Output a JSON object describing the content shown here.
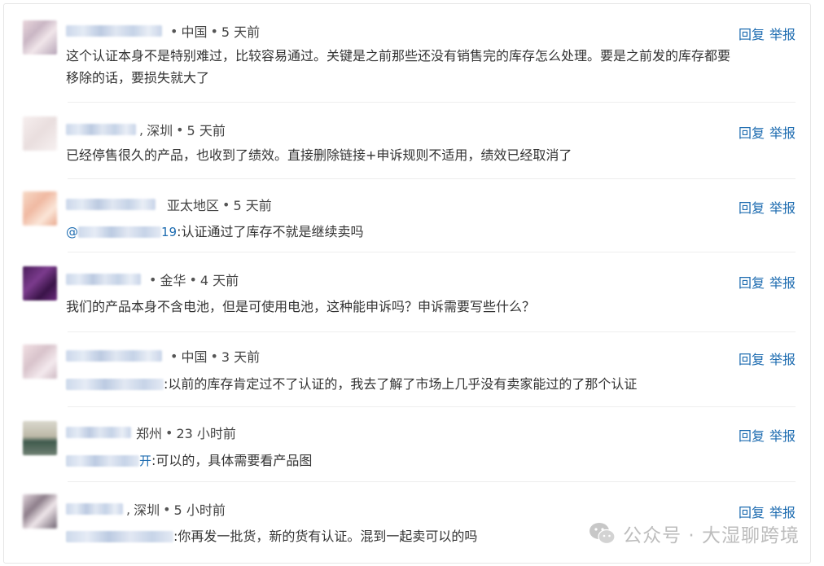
{
  "action_reply": "回复",
  "action_report": "举报",
  "comments": [
    {
      "location": "中国",
      "time": "5 天前",
      "text_line1": "这个认证本身不是特别难过，比较容易通过。关键是之前那些还没有销售完的库存怎么处理。要是之前发的库存都要",
      "text_line2": "移除的话，要损失就大了"
    },
    {
      "location": "深圳",
      "time": "5 天前",
      "text_line1": "已经停售很久的产品，也收到了绩效。直接删除链接+申诉规则不适用，绩效已经取消了"
    },
    {
      "location": "亚太地区",
      "time": "5 天前",
      "mention_prefix": "@",
      "mention_suffix": "19",
      "text_line1": ":认证通过了库存不就是继续卖吗"
    },
    {
      "location": "金华",
      "time": "4 天前",
      "text_line1": "我们的产品本身不含电池，但是可使用电池，这种能申诉吗？申诉需要写些什么？"
    },
    {
      "location": "中国",
      "time": "3 天前",
      "text_line1": ":以前的库存肯定过不了认证的，我去了解了市场上几乎没有卖家能过的了那个认证"
    },
    {
      "location": "郑州",
      "time": "23 小时前",
      "mention_suffix": "开",
      "text_line1": ":可以的，具体需要看产品图"
    },
    {
      "location": "深圳",
      "time": "5 小时前",
      "text_line1": ":你再发一批货，新的货有认证。混到一起卖可以的吗"
    }
  ],
  "watermark": {
    "text": "公众号 · 大湿聊跨境"
  },
  "colors": {
    "link": "#1c6bb0",
    "text": "#333333",
    "divider": "#eeeeee",
    "watermark": "#bdbdbd"
  }
}
